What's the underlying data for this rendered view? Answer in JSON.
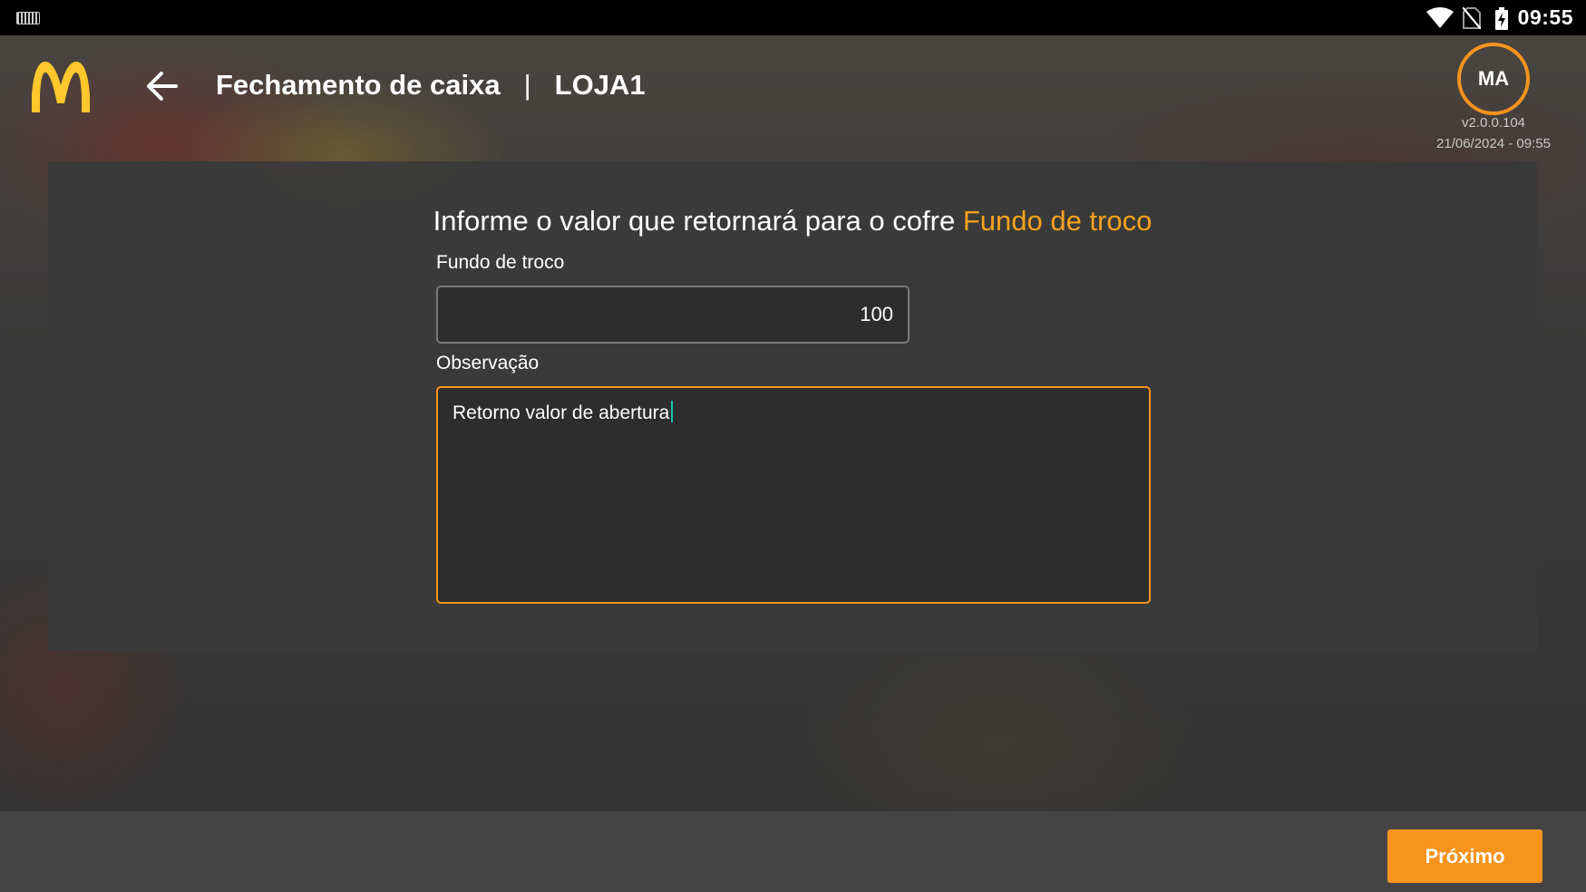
{
  "status_bar": {
    "time": "09:55",
    "icons": [
      "keyboard-icon",
      "wifi-icon",
      "no-sim-icon",
      "battery-charging-icon"
    ]
  },
  "header": {
    "title": "Fechamento de caixa",
    "separator": "|",
    "store": "LOJA1",
    "avatar_initials": "MA",
    "version": "v2.0.0.104",
    "datetime": "21/06/2024 - 09:55"
  },
  "form": {
    "prompt_text": "Informe o valor que retornará para o cofre ",
    "prompt_highlight": "Fundo de troco",
    "amount_label": "Fundo de troco",
    "amount_value": "100",
    "observation_label": "Observação",
    "observation_value": "Retorno valor de abertura"
  },
  "footer": {
    "next_label": "Próximo"
  },
  "colors": {
    "accent": "#f7941d",
    "highlight_text": "#f7a21c",
    "logo_yellow": "#ffc72c",
    "caret": "#19c2a8"
  }
}
